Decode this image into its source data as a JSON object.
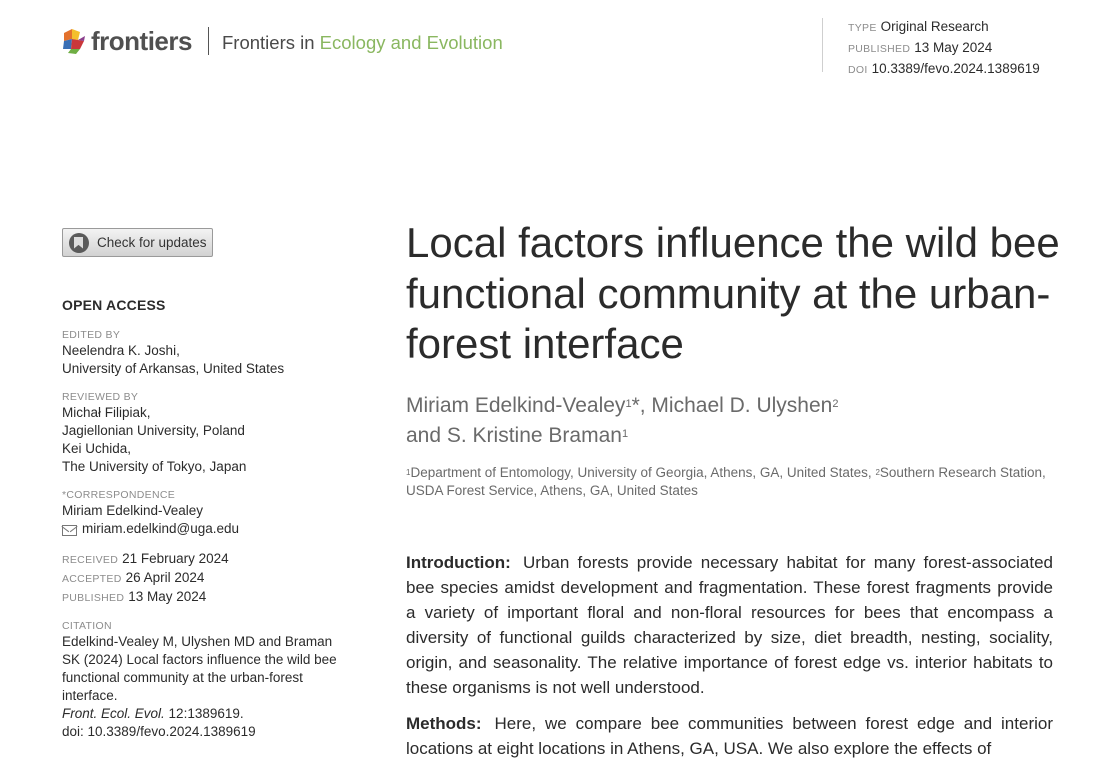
{
  "header": {
    "logo_text": "frontiers",
    "journal_prefix": "Frontiers in",
    "journal_name": "Ecology and Evolution",
    "meta": [
      {
        "label": "TYPE",
        "value": "Original Research"
      },
      {
        "label": "PUBLISHED",
        "value": "13 May 2024"
      },
      {
        "label": "DOI",
        "value": "10.3389/fevo.2024.1389619"
      }
    ]
  },
  "sidebar": {
    "check_updates_label": "Check for updates",
    "open_access": "OPEN ACCESS",
    "edited_by": {
      "label": "EDITED BY",
      "lines": [
        "Neelendra K. Joshi,",
        "University of Arkansas, United States"
      ]
    },
    "reviewed_by": {
      "label": "REVIEWED BY",
      "lines": [
        "Michał Filipiak,",
        "Jagiellonian University, Poland",
        "Kei Uchida,",
        "The University of Tokyo, Japan"
      ]
    },
    "correspondence": {
      "label": "*CORRESPONDENCE",
      "name": "Miriam Edelkind-Vealey",
      "email": "miriam.edelkind@uga.edu"
    },
    "dates": [
      {
        "label": "RECEIVED",
        "value": "21 February 2024"
      },
      {
        "label": "ACCEPTED",
        "value": "26 April 2024"
      },
      {
        "label": "PUBLISHED",
        "value": "13 May 2024"
      }
    ],
    "citation": {
      "label": "CITATION",
      "text": "Edelkind-Vealey M, Ulyshen MD and Braman SK (2024) Local factors influence the wild bee functional community at the urban-forest interface.",
      "journal_abbrev": "Front. Ecol. Evol.",
      "volume": " 12:1389619.",
      "doi": "doi: 10.3389/fevo.2024.1389619"
    }
  },
  "article": {
    "title": "Local factors influence the wild bee functional community at the urban-forest interface",
    "authors": [
      {
        "name": "Miriam Edelkind-Vealey",
        "sup": "1",
        "mark": "*",
        "sep": ", "
      },
      {
        "name": "Michael D. Ulyshen",
        "sup": "2",
        "mark": "",
        "sep": " and "
      },
      {
        "name": "S. Kristine Braman",
        "sup": "1",
        "mark": "",
        "sep": ""
      }
    ],
    "affiliations": [
      {
        "sup": "1",
        "text": "Department of Entomology, University of Georgia, Athens, GA, United States, "
      },
      {
        "sup": "2",
        "text": "Southern Research Station, USDA Forest Service, Athens, GA, United States"
      }
    ],
    "abstract": [
      {
        "head": "Introduction:",
        "text": "Urban forests provide necessary habitat for many forest-associated bee species amidst development and fragmentation. These forest fragments provide a variety of important floral and non-floral resources for bees that encompass a diversity of functional guilds characterized by size, diet breadth, nesting, sociality, origin, and seasonality. The relative importance of forest edge vs. interior habitats to these organisms is not well understood."
      },
      {
        "head": "Methods:",
        "text": "Here, we compare bee communities between forest edge and interior locations at eight locations in Athens, GA, USA. We also explore the effects of"
      }
    ]
  }
}
